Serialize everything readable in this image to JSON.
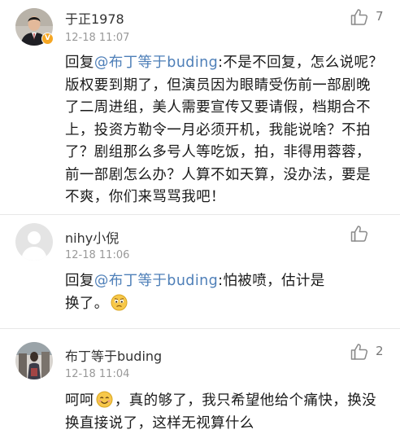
{
  "comments": [
    {
      "user": "于正1978",
      "time": "12-18 11:07",
      "likes": "7",
      "reply_prefix": "回复",
      "mention": "@布丁等于buding",
      "body": ":不是不回复，怎么说呢？版权要到期了，但演员因为眼睛受伤前一部剧晚了二周进组，美人需要宣传又要请假，档期合不上，投资方勒令一月必须开机，我能说啥？不拍了？剧组那么多号人等吃饭，拍，非得用蓉蓉，前一部剧怎么办？人算不如天算，没办法，要是不爽，你们来骂骂我吧！",
      "verified_badge": "V"
    },
    {
      "user": "nihy小倪",
      "time": "12-18 11:06",
      "likes": "",
      "reply_prefix": "回复",
      "mention": "@布丁等于buding",
      "body": ":怕被喷，估计是换了。",
      "emoji": "worried-face"
    },
    {
      "user": "布丁等于buding",
      "time": "12-18 11:04",
      "likes": "2",
      "body_before_emoji": "呵呵",
      "emoji": "smile-face",
      "body_after_emoji": "，真的够了，我只希望他给个痛快，换没换直接说了，这样无视算什么"
    }
  ],
  "colors": {
    "mention": "#4e7fb8",
    "text": "#1a1a1a",
    "meta": "#999999",
    "verified": "#f5a623"
  }
}
